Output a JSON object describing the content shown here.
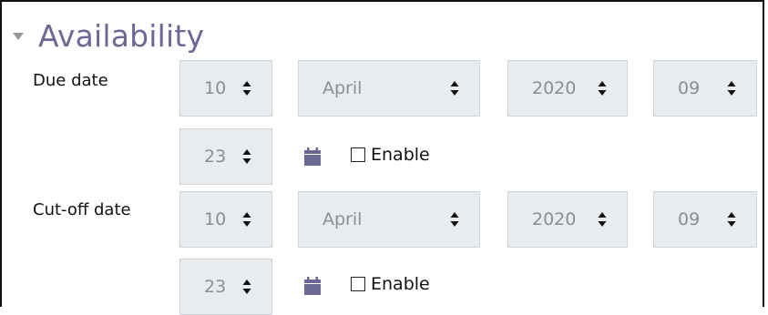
{
  "section": {
    "title": "Availability",
    "collapse_icon": "caret-down-icon"
  },
  "due_date": {
    "label": "Due date",
    "day": "10",
    "month": "April",
    "year": "2020",
    "hour": "09",
    "minute": "23",
    "calendar_icon": "calendar-icon",
    "enable_label": "Enable",
    "enabled": false
  },
  "cutoff_date": {
    "label": "Cut-off date",
    "day": "10",
    "month": "April",
    "year": "2020",
    "hour": "09",
    "minute": "23",
    "calendar_icon": "calendar-icon",
    "enable_label": "Enable",
    "enabled": false
  },
  "colors": {
    "title": "#6c6996",
    "select_bg": "#e9ecef",
    "select_text": "#8a8f96",
    "calendar_icon": "#6c6996"
  }
}
